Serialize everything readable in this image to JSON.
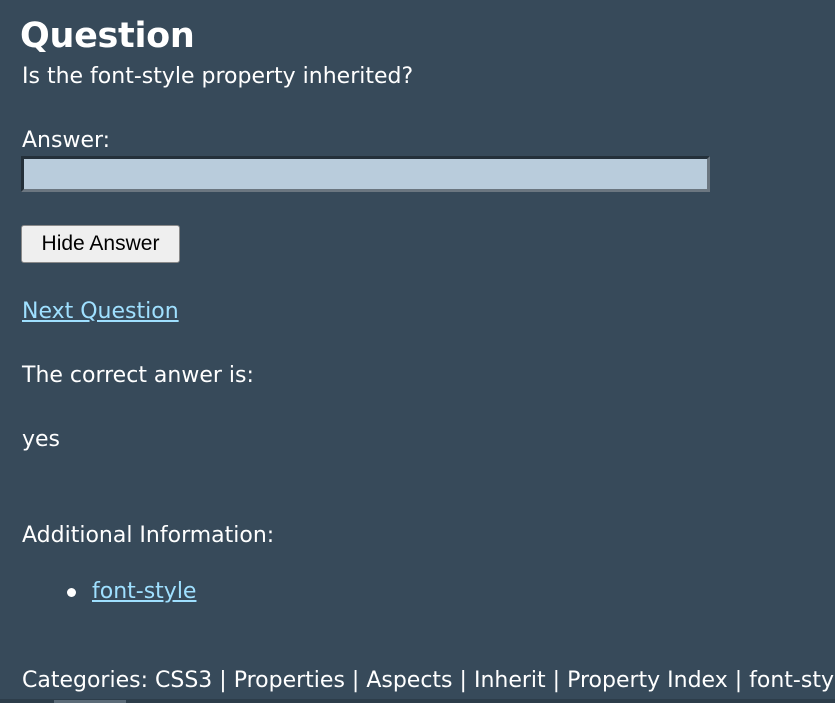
{
  "question": {
    "heading": "Question",
    "text": "Is the font-style property inherited?"
  },
  "answer": {
    "label": "Answer:",
    "value": "",
    "placeholder": ""
  },
  "actions": {
    "hide_answer_label": "Hide Answer",
    "next_question_label": "Next Question"
  },
  "result": {
    "correct_label": "The correct anwer is:",
    "correct_value": "yes"
  },
  "additional_info": {
    "label": "Additional Information:",
    "links": [
      "font-style"
    ]
  },
  "categories": {
    "prefix": "Categories:",
    "items": [
      "CSS3",
      "Properties",
      "Aspects",
      "Inherit",
      "Property Index",
      "font-style"
    ],
    "separator": "|"
  },
  "colors": {
    "background": "#374a5a",
    "text": "#ffffff",
    "link": "#9fe0ff",
    "input_background": "#b9ccdc",
    "button_background": "#efefef"
  }
}
